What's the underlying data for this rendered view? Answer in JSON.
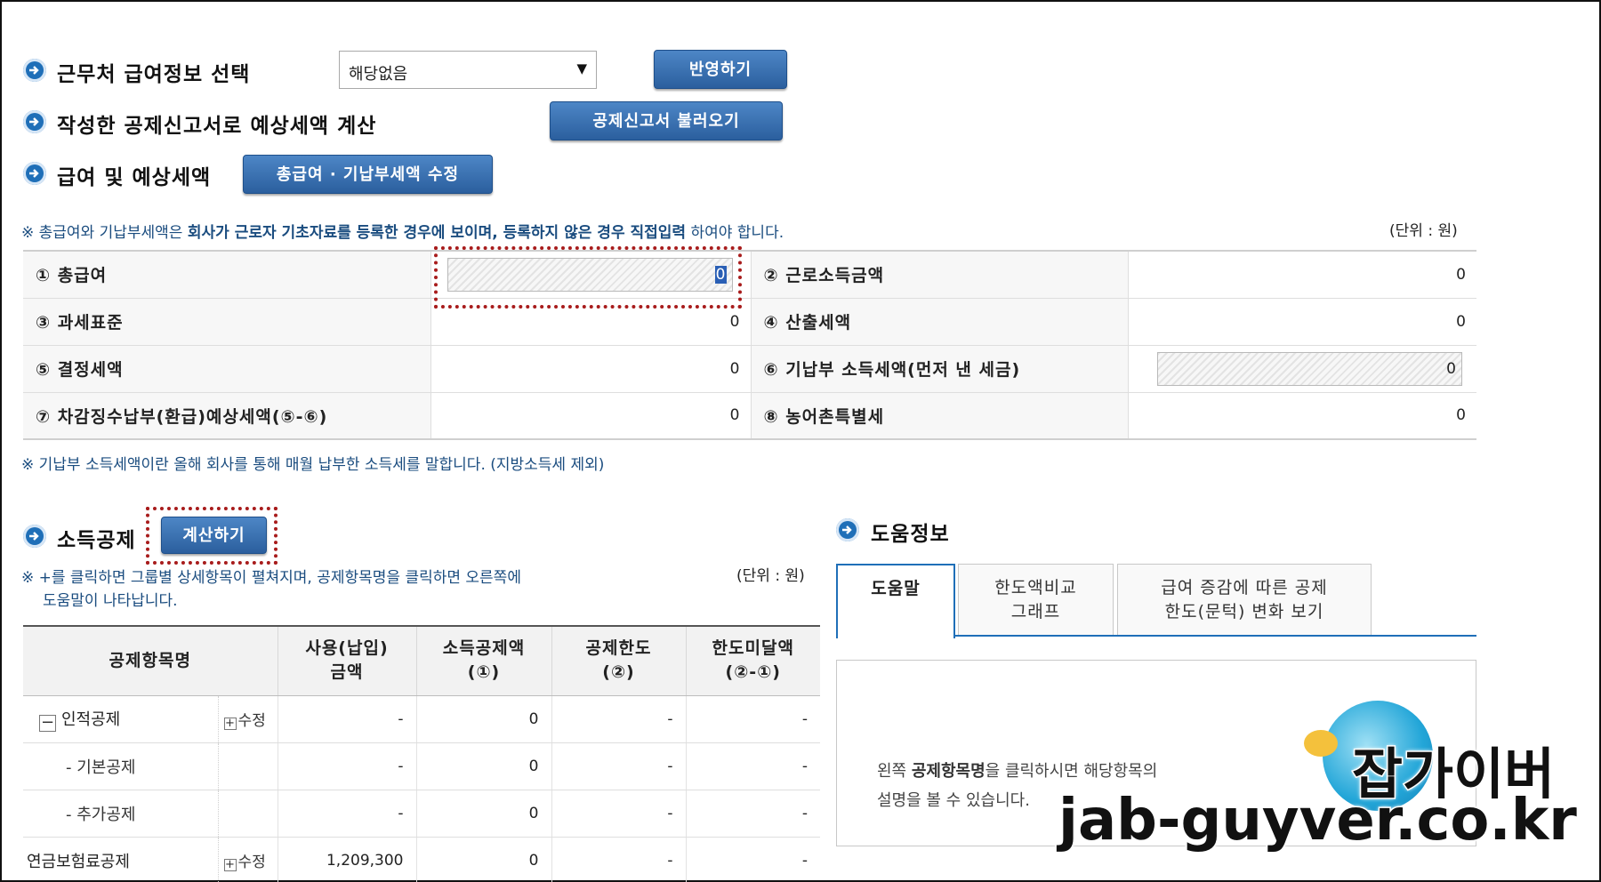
{
  "top": {
    "section1_title": "근무처 급여정보 선택",
    "select_value": "해당없음",
    "apply_button": "반영하기",
    "section2_title": "작성한 공제신고서로 예상세액 계산",
    "load_button": "공제신고서 불러오기",
    "section3_title": "급여 및 예상세액",
    "edit_salary_button": "총급여 · 기납부세액 수정"
  },
  "notice": {
    "prefix": "※ 총급여와 기납부세액은 ",
    "bold1": "회사가 근로자 기초자료를 등록한 경우에 보이며, 등록하지 않은 경우 직접입력",
    "suffix": " 하여야 합니다.",
    "unit": "(단위 : 원)"
  },
  "salary_table": {
    "r1": {
      "l1": "① 총급여",
      "v1": "0",
      "l2": "② 근로소득금액",
      "v2": "0"
    },
    "r2": {
      "l1": "③ 과세표준",
      "v1": "0",
      "l2": "④ 산출세액",
      "v2": "0"
    },
    "r3": {
      "l1": "⑤ 결정세액",
      "v1": "0",
      "l2": "⑥ 기납부 소득세액(먼저 낸 세금)",
      "v2": "0"
    },
    "r4": {
      "l1": "⑦ 차감징수납부(환급)예상세액(⑤-⑥)",
      "v1": "0",
      "l2": "⑧ 농어촌특별세",
      "v2": "0"
    }
  },
  "notice2": "※ 기납부 소득세액이란 올해 회사를 통해 매월 납부한 소득세를 말합니다. (지방소득세 제외)",
  "deduction": {
    "title": "소득공제",
    "calc_button": "계산하기",
    "note_line1": "※ +를 클릭하면 그룹별 상세항목이 펼쳐지며, 공제항목명을 클릭하면 오른쪽에",
    "note_line2": "도움말이 나타납니다.",
    "unit": "(단위 : 원)",
    "headers": {
      "name": "공제항목명",
      "used1": "사용(납입)",
      "used2": "금액",
      "amt1": "소득공제액",
      "amt2": "(①)",
      "limit1": "공제한도",
      "limit2": "(②)",
      "rest1": "한도미달액",
      "rest2": "(②-①)"
    },
    "rows": [
      {
        "icon": "−",
        "name": "인적공제",
        "edit": "수정",
        "used": "-",
        "amt": "0",
        "limit": "-",
        "rest": "-"
      },
      {
        "name": "- 기본공제",
        "used": "-",
        "amt": "0",
        "limit": "-",
        "rest": "-"
      },
      {
        "name": "- 추가공제",
        "used": "-",
        "amt": "0",
        "limit": "-",
        "rest": "-"
      },
      {
        "name": "연금보험료공제",
        "edit": "수정",
        "used": "1,209,300",
        "amt": "0",
        "limit": "-",
        "rest": "-"
      }
    ]
  },
  "help": {
    "title": "도움정보",
    "tab1": "도움말",
    "tab2_line1": "한도액비교",
    "tab2_line2": "그래프",
    "tab3_line1": "급여 증감에 따른 공제",
    "tab3_line2": "한도(문턱) 변화 보기",
    "text_pre": "왼쪽 ",
    "text_bold": "공제항목명",
    "text_post": "을 클릭하시면 해당항목의",
    "text_line2": "설명을 볼 수 있습니다."
  },
  "watermark": {
    "line1": "잡가이버",
    "line2": "jab-guyver.co.kr"
  }
}
